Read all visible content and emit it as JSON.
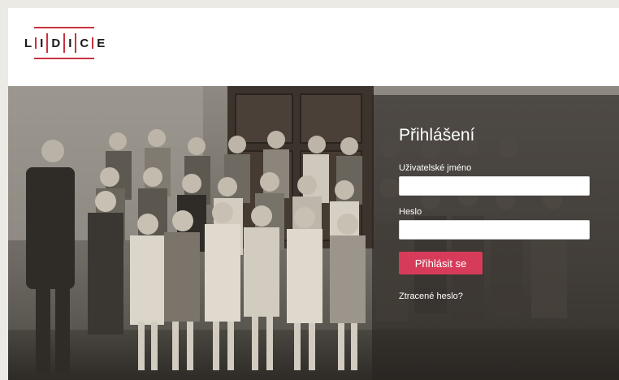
{
  "brand": {
    "logo_letters": [
      "L",
      "I",
      "D",
      "I",
      "C",
      "E"
    ]
  },
  "login": {
    "title": "Přihlášení",
    "username_label": "Uživatelské jméno",
    "username_value": "",
    "password_label": "Heslo",
    "password_value": "",
    "submit_label": "Přihlásit se",
    "forgot_label": "Ztracené heslo?"
  },
  "colors": {
    "accent": "#d63c5a",
    "logo_red": "#c8323f",
    "panel_overlay": "rgba(40,36,32,0.62)",
    "page_background": "#eceae4"
  }
}
